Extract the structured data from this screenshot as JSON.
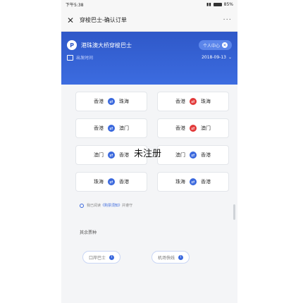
{
  "status_bar": {
    "time": "下午5:38",
    "battery": "85%"
  },
  "navbar": {
    "title": "穿梭巴士-确认订单",
    "more": "···",
    "close": "✕"
  },
  "banner": {
    "brand": "港珠澳大桥穿梭巴士",
    "user_center": "个人中心",
    "time_label": "出发时间",
    "date": "2018-09-13"
  },
  "routes": [
    {
      "from": "香港",
      "to": "珠海",
      "color": "#3a68dd"
    },
    {
      "from": "香港",
      "to": "珠海",
      "color": "#e23a3a"
    },
    {
      "from": "香港",
      "to": "澳门",
      "color": "#3a68dd"
    },
    {
      "from": "香港",
      "to": "澳门",
      "color": "#e23a3a"
    },
    {
      "from": "澳门",
      "to": "香港",
      "color": "#3a68dd"
    },
    {
      "from": "澳门",
      "to": "香港",
      "color": "#3a68dd"
    },
    {
      "from": "珠海",
      "to": "香港",
      "color": "#3a68dd"
    },
    {
      "from": "珠海",
      "to": "香港",
      "color": "#3a68dd"
    }
  ],
  "watermark": "未注册",
  "notice": {
    "prefix": "我已阅读",
    "link": "《购票须知》",
    "suffix": "并遵守"
  },
  "other_section": {
    "title": "其余票种"
  },
  "other_tickets": [
    {
      "label": "口岸巴士"
    },
    {
      "label": "机场快线"
    }
  ]
}
